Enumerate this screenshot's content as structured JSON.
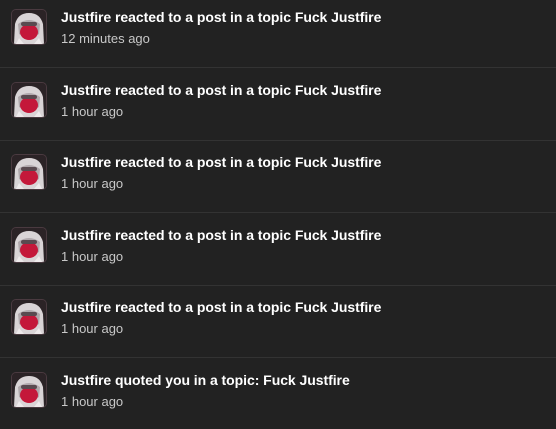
{
  "notifications": [
    {
      "text": "Justfire reacted to a post in a topic Fuck Justfire",
      "time": "12 minutes ago"
    },
    {
      "text": "Justfire reacted to a post in a topic Fuck Justfire",
      "time": "1 hour ago"
    },
    {
      "text": "Justfire reacted to a post in a topic Fuck Justfire",
      "time": "1 hour ago"
    },
    {
      "text": "Justfire reacted to a post in a topic Fuck Justfire",
      "time": "1 hour ago"
    },
    {
      "text": "Justfire reacted to a post in a topic Fuck Justfire",
      "time": "1 hour ago"
    },
    {
      "text": "Justfire quoted you in a topic: Fuck Justfire",
      "time": "1 hour ago"
    }
  ],
  "colors": {
    "background": "#222222",
    "divider": "#333333",
    "text_primary": "#ffffff",
    "text_secondary": "#c8c8c8",
    "avatar_accent": "#c4183a"
  }
}
